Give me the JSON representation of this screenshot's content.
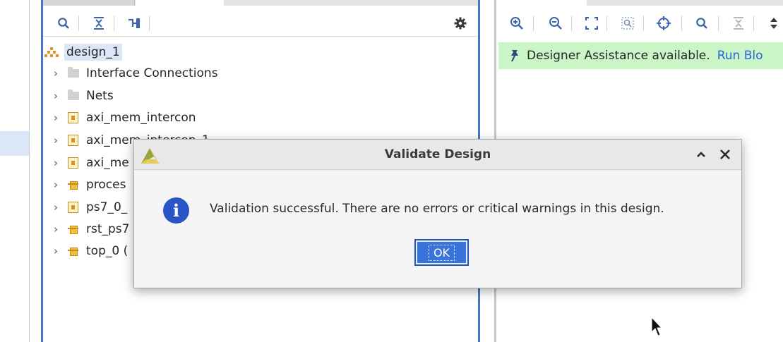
{
  "hierarchy": {
    "root_label": "design_1",
    "items": [
      {
        "label": "Interface Connections",
        "icon": "folder"
      },
      {
        "label": "Nets",
        "icon": "folder"
      },
      {
        "label": "axi_mem_intercon",
        "icon": "block"
      },
      {
        "label": "axi_mem_intercon_1",
        "icon": "block"
      },
      {
        "label": "axi_me",
        "icon": "block"
      },
      {
        "label": "proces",
        "icon": "ip"
      },
      {
        "label": "ps7_0_",
        "icon": "block"
      },
      {
        "label": "rst_ps7",
        "icon": "ip"
      },
      {
        "label": "top_0 (",
        "icon": "ip"
      }
    ]
  },
  "assistance": {
    "text": "Designer Assistance available.",
    "link": "Run Blo"
  },
  "dialog": {
    "title": "Validate Design",
    "message": "Validation successful. There are no errors or critical warnings in this design.",
    "ok_label": "OK",
    "icon": "info-icon"
  },
  "colors": {
    "accent": "#4a74c4",
    "assist_bg": "#c9f5c7",
    "link": "#2b63d6",
    "ok_button": "#3a73d9",
    "info_icon": "#2a55c8"
  }
}
